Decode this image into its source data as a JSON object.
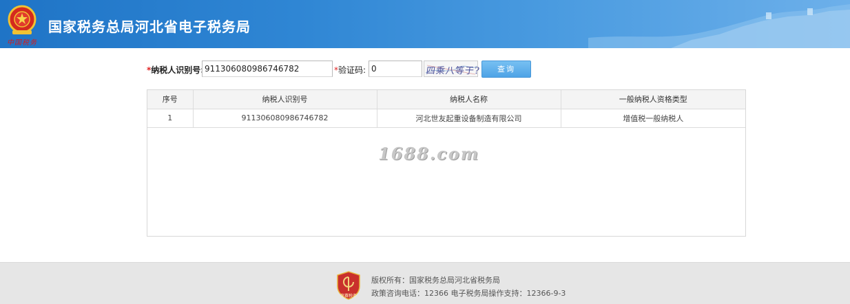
{
  "header": {
    "title": "国家税务总局河北省电子税务局",
    "emblem_caption": "中国税务",
    "colors": {
      "gradient_start": "#1f74c6",
      "gradient_end": "#6db0ea"
    }
  },
  "query": {
    "taxpayer_id_required_mark": "*",
    "taxpayer_id_label": "纳税人识别号:",
    "taxpayer_id_value": "911306080986746782",
    "captcha_required_mark": "*",
    "captcha_label": "验证码:",
    "captcha_value": "0",
    "captcha_image_text": "四乘八等于?",
    "search_button_label": "查询"
  },
  "table": {
    "columns": [
      "序号",
      "纳税人识别号",
      "纳税人名称",
      "一般纳税人资格类型"
    ],
    "rows": [
      [
        "1",
        "911306080986746782",
        "河北世友起重设备制造有限公司",
        "增值税一般纳税人"
      ]
    ]
  },
  "watermark": "1688.com",
  "footer": {
    "badge_caption": "竞赛税务",
    "copyright": "版权所有：国家税务总局河北省税务局",
    "contact": "政策咨询电话：12366  电子税务局操作支持：12366-9-3"
  },
  "icons": {
    "header_emblem": "tax-emblem-icon",
    "footer_badge": "shield-badge-icon"
  }
}
